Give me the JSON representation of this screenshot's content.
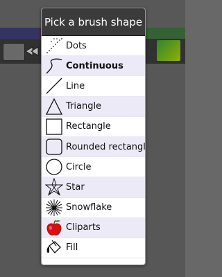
{
  "dialog": {
    "title": "Pick a brush shape",
    "items": [
      {
        "label": "Dots",
        "icon": "dots-icon"
      },
      {
        "label": "Continuous",
        "icon": "continuous-icon",
        "selected": true
      },
      {
        "label": "Line",
        "icon": "line-icon"
      },
      {
        "label": "Triangle",
        "icon": "triangle-icon"
      },
      {
        "label": "Rectangle",
        "icon": "rectangle-icon"
      },
      {
        "label": "Rounded rectangle",
        "icon": "rounded-rectangle-icon"
      },
      {
        "label": "Circle",
        "icon": "circle-icon"
      },
      {
        "label": "Star",
        "icon": "star-icon"
      },
      {
        "label": "Snowflake",
        "icon": "snowflake-icon"
      },
      {
        "label": "Cliparts",
        "icon": "apple-icon"
      },
      {
        "label": "Fill",
        "icon": "paint-bucket-icon"
      }
    ]
  },
  "colors": {
    "header_bg": "#3b3b3b",
    "row_alt_bg": "#ebeaf6",
    "backdrop": "#686868"
  }
}
